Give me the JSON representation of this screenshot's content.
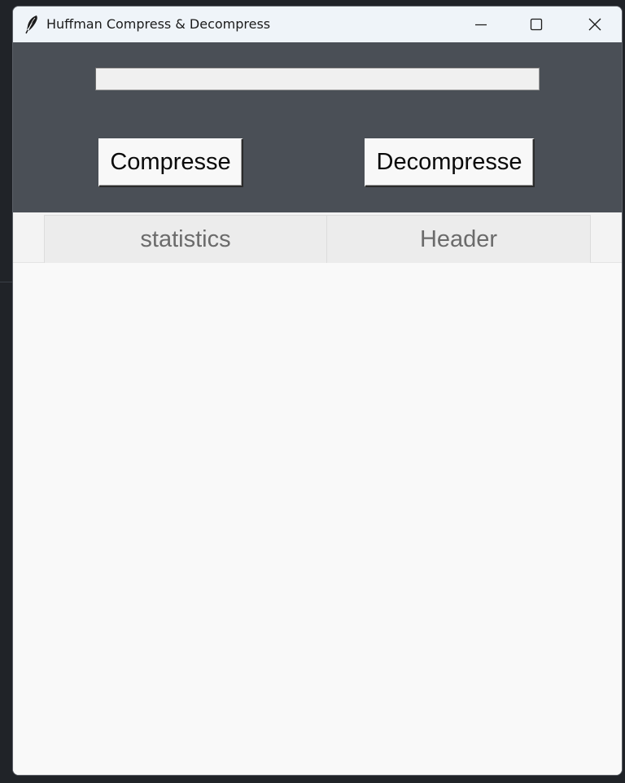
{
  "window": {
    "title": "Huffman Compress & Decompress",
    "icon": "feather-icon",
    "controls": [
      "minimize-icon",
      "maximize-icon",
      "close-icon"
    ]
  },
  "input": {
    "file_path_value": "",
    "placeholder": ""
  },
  "buttons": {
    "compress_label": "Compresse",
    "decompress_label": "Decompresse"
  },
  "tabs": [
    {
      "label": "statistics"
    },
    {
      "label": "Header"
    }
  ],
  "colors": {
    "top_panel": "#4a4f56",
    "titlebar": "#eff4f9",
    "content_background": "#f9f9f9",
    "tab_background": "#ececec",
    "tab_text": "#6b6b6b"
  }
}
